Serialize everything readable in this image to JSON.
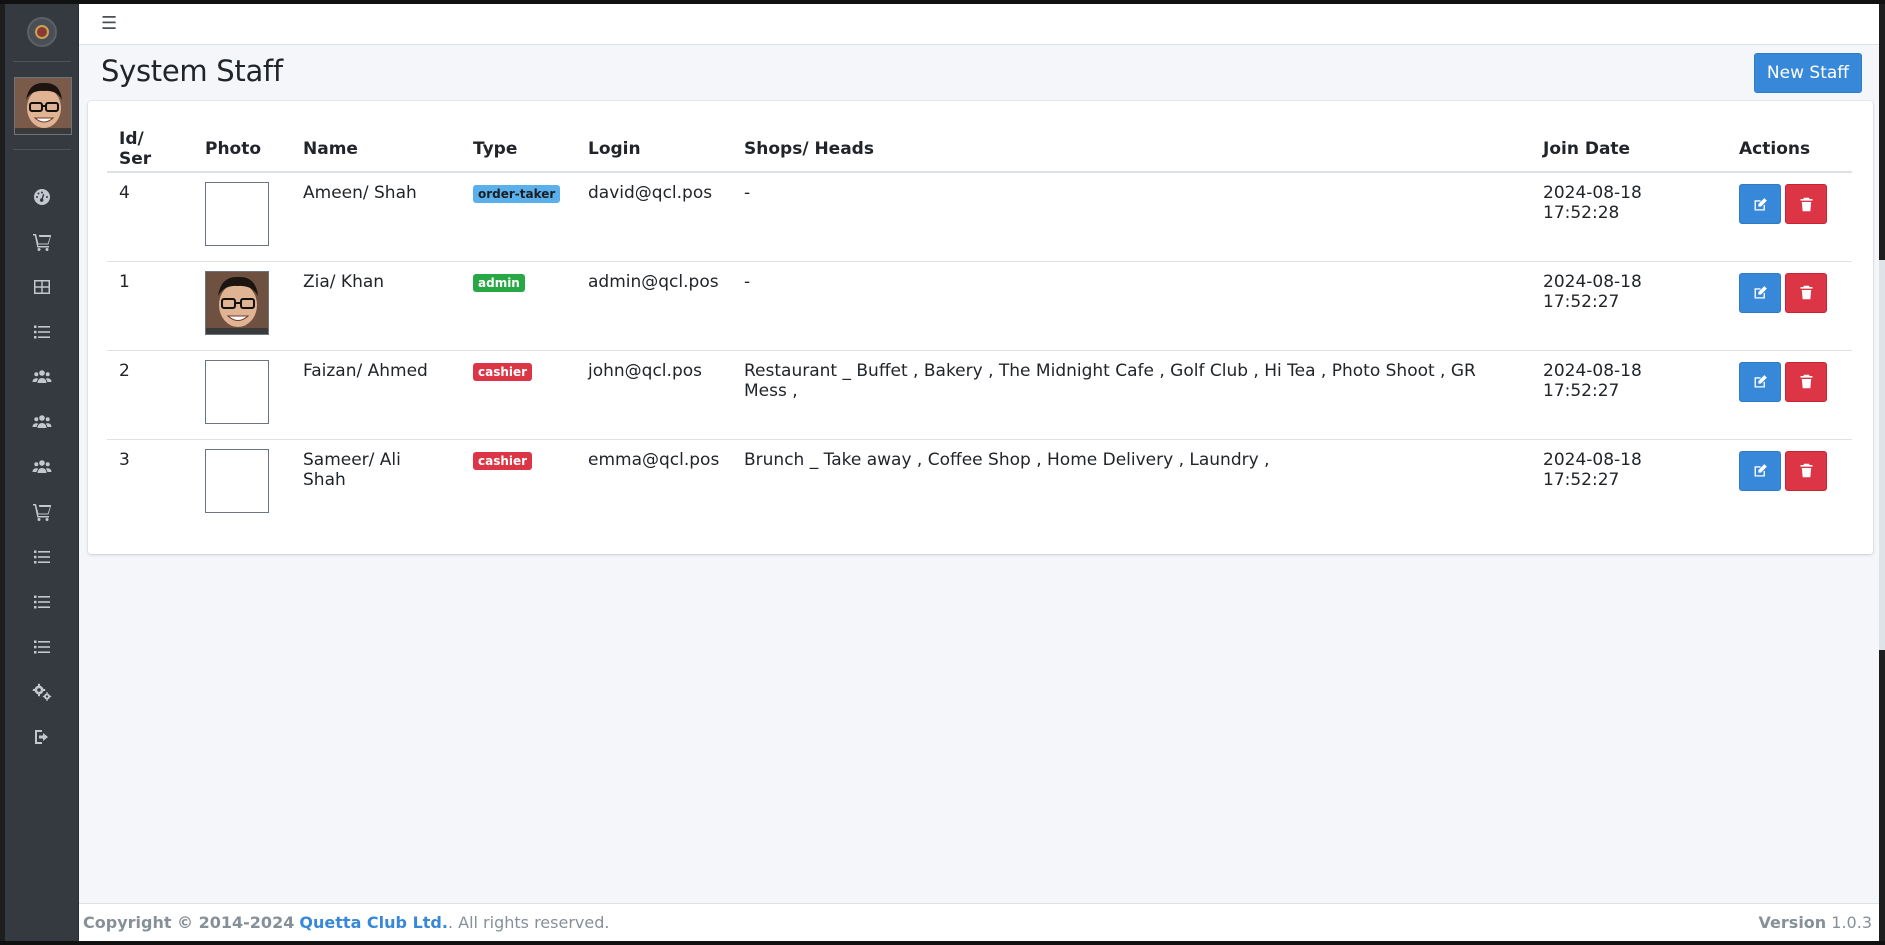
{
  "page": {
    "title": "System Staff",
    "new_button": "New Staff"
  },
  "sidebar": {
    "icons": [
      "dashboard-icon",
      "cart-icon",
      "table-icon",
      "list-icon",
      "users-icon",
      "users-icon",
      "users-icon",
      "cart-icon",
      "list-icon",
      "list-icon",
      "list-icon",
      "settings-icon",
      "logout-icon"
    ]
  },
  "table": {
    "headers": {
      "id": "Id/ Ser",
      "photo": "Photo",
      "name": "Name",
      "type": "Type",
      "login": "Login",
      "shops": "Shops/ Heads",
      "join": "Join Date",
      "actions": "Actions"
    },
    "rows": [
      {
        "id": "4",
        "has_photo": false,
        "name": "Ameen/ Shah",
        "type": "order-taker",
        "type_color": "#5ab0ea",
        "login": "david@qcl.pos",
        "shops": "-",
        "join": "2024-08-18 17:52:28"
      },
      {
        "id": "1",
        "has_photo": true,
        "name": "Zia/ Khan",
        "type": "admin",
        "type_color": "#28a745",
        "login": "admin@qcl.pos",
        "shops": "-",
        "join": "2024-08-18 17:52:27"
      },
      {
        "id": "2",
        "has_photo": false,
        "name": "Faizan/ Ahmed",
        "type": "cashier",
        "type_color": "#dc3545",
        "login": "john@qcl.pos",
        "shops": "Restaurant _ Buffet , Bakery , The Midnight Cafe , Golf Club , Hi Tea , Photo Shoot , GR Mess ,",
        "join": "2024-08-18 17:52:27"
      },
      {
        "id": "3",
        "has_photo": false,
        "name": "Sameer/ Ali Shah",
        "type": "cashier",
        "type_color": "#dc3545",
        "login": "emma@qcl.pos",
        "shops": "Brunch _ Take away , Coffee Shop , Home Delivery , Laundry ,",
        "join": "2024-08-18 17:52:27"
      }
    ]
  },
  "footer": {
    "copyright": "Copyright © 2014-2024",
    "company": "Quetta Club Ltd.",
    "rights": ". All rights reserved.",
    "version_label": "Version",
    "version": "1.0.3"
  },
  "colors": {
    "primary": "#3788d8",
    "danger": "#dc3545",
    "success": "#28a745",
    "sidebar": "#343a40"
  }
}
